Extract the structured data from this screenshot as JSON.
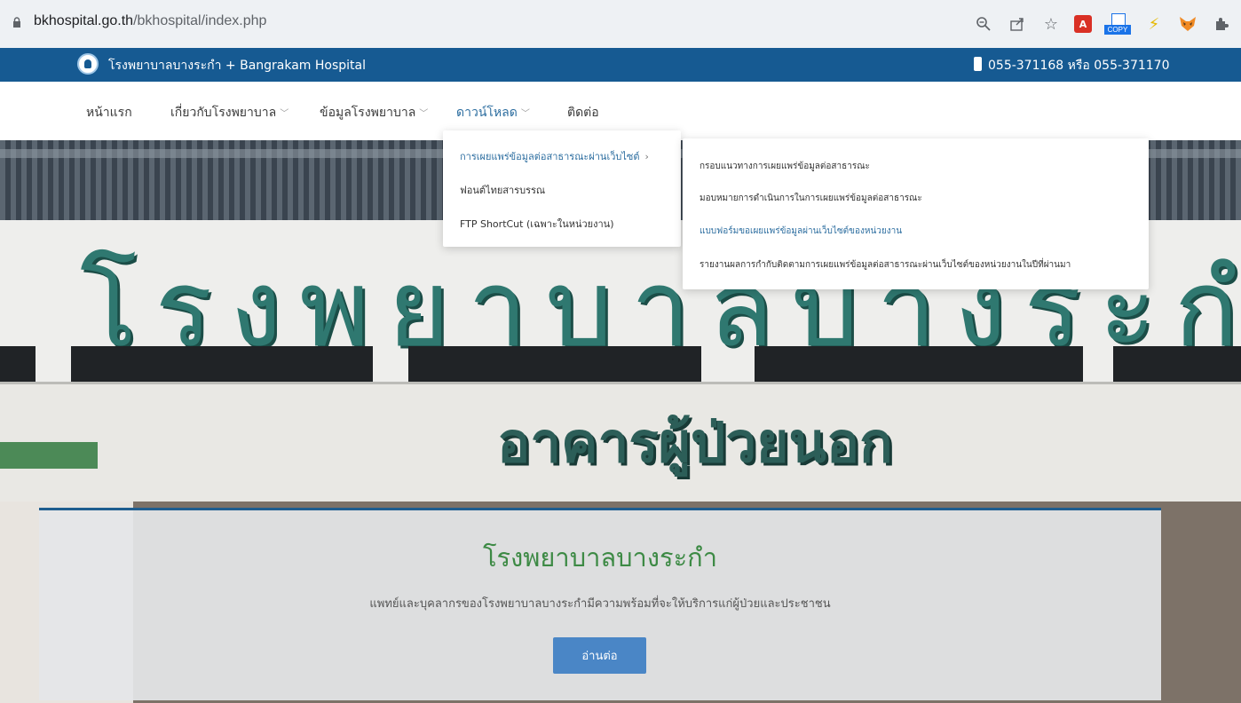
{
  "browser": {
    "url_host": "bkhospital.go.th",
    "url_path": "/bkhospital/index.php",
    "copy_label": "COPY",
    "pdf_label": "A"
  },
  "topbar": {
    "site_name": "โรงพยาบาลบางระกำ + Bangrakam Hospital",
    "phone": "055-371168 หรือ 055-371170"
  },
  "nav": {
    "items": [
      {
        "label": "หน้าแรก"
      },
      {
        "label": "เกี่ยวกับโรงพยาบาล"
      },
      {
        "label": "ข้อมูลโรงพยาบาล"
      },
      {
        "label": "ดาวน์โหลด"
      },
      {
        "label": "ติดต่อ"
      }
    ]
  },
  "dropdown": {
    "items": [
      {
        "label": "การเผยแพร่ข้อมูลต่อสาธารณะผ่านเว็บไซต์"
      },
      {
        "label": "ฟอนต์ไทยสารบรรณ"
      },
      {
        "label": "FTP ShortCut (เฉพาะในหน่วยงาน)"
      }
    ]
  },
  "subdropdown": {
    "items": [
      {
        "label": "กรอบแนวทางการเผยแพร่ข้อมูลต่อสาธารณะ"
      },
      {
        "label": "มอบหมายการดำเนินการในการเผยแพร่ข้อมูลต่อสาธารณะ"
      },
      {
        "label": "แบบฟอร์มขอเผยแพร่ข้อมูลผ่านเว็บไซต์ของหน่วยงาน"
      },
      {
        "label": "รายงานผลการกำกับติดตามการเผยแพร่ข้อมูลต่อสาธารณะผ่านเว็บไซต์ของหน่วยงานในปีที่ผ่านมา"
      }
    ]
  },
  "hero": {
    "sign_main": "โรงพยาบาลบางระกำ",
    "sign_building": "อาคารผู้ป่วยนอก",
    "caption_title": "โรงพยาบาลบางระกำ",
    "caption_subtitle": "แพทย์และบุคลากรของโรงพยาบาลบางระกำมีความพร้อมที่จะให้บริการแก่ผู้ป่วยและประชาชน",
    "button_label": "อ่านต่อ"
  },
  "colors": {
    "topbar": "#165a92",
    "nav_active": "#2d6ea0",
    "caption_title": "#3d8a45",
    "button": "#4a86c6"
  }
}
